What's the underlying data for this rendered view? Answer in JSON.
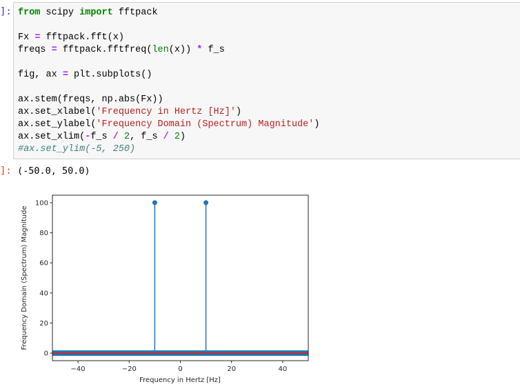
{
  "cell": {
    "in_prompt": "]:",
    "out_prompt": "]:",
    "code": {
      "l1": [
        "from",
        " scipy ",
        "import",
        " fftpack"
      ],
      "l2": [
        "Fx ",
        "=",
        " fftpack.fft(x)"
      ],
      "l3": [
        "freqs ",
        "=",
        " fftpack.fftfreq(",
        "len",
        "(x)) ",
        "*",
        " f_s"
      ],
      "l4": [
        "fig, ax ",
        "=",
        " plt.subplots()"
      ],
      "l5": "ax.stem(freqs, np.abs(Fx))",
      "l6": [
        "ax.set_xlabel(",
        "'Frequency in Hertz [Hz]'",
        ")"
      ],
      "l7": [
        "ax.set_ylabel(",
        "'Frequency Domain (Spectrum) Magnitude'",
        ")"
      ],
      "l8": [
        "ax.set_xlim(",
        "-",
        "f_s ",
        "/",
        " ",
        "2",
        ", f_s ",
        "/",
        " ",
        "2",
        ")"
      ],
      "l9": "#ax.set_ylim(-5, 250)"
    },
    "output_text": "(-50.0, 50.0)"
  },
  "chart_data": {
    "type": "stem",
    "xlabel": "Frequency in Hertz [Hz]",
    "ylabel": "Frequency Domain (Spectrum) Magnitude",
    "xlim": [
      -50,
      50
    ],
    "ylim": [
      -5,
      105
    ],
    "xticks": [
      -40,
      -20,
      0,
      20,
      40
    ],
    "xtick_labels": [
      "−40",
      "−20",
      "0",
      "20",
      "40"
    ],
    "yticks": [
      0,
      20,
      40,
      60,
      80,
      100
    ],
    "ytick_labels": [
      "0",
      "20",
      "40",
      "60",
      "80",
      "100"
    ],
    "stems": [
      {
        "x": -10,
        "y": 100
      },
      {
        "x": 10,
        "y": 100
      }
    ],
    "baseline": 0,
    "stem_color": "#1f77b4",
    "baseline_color": "#d62728"
  }
}
